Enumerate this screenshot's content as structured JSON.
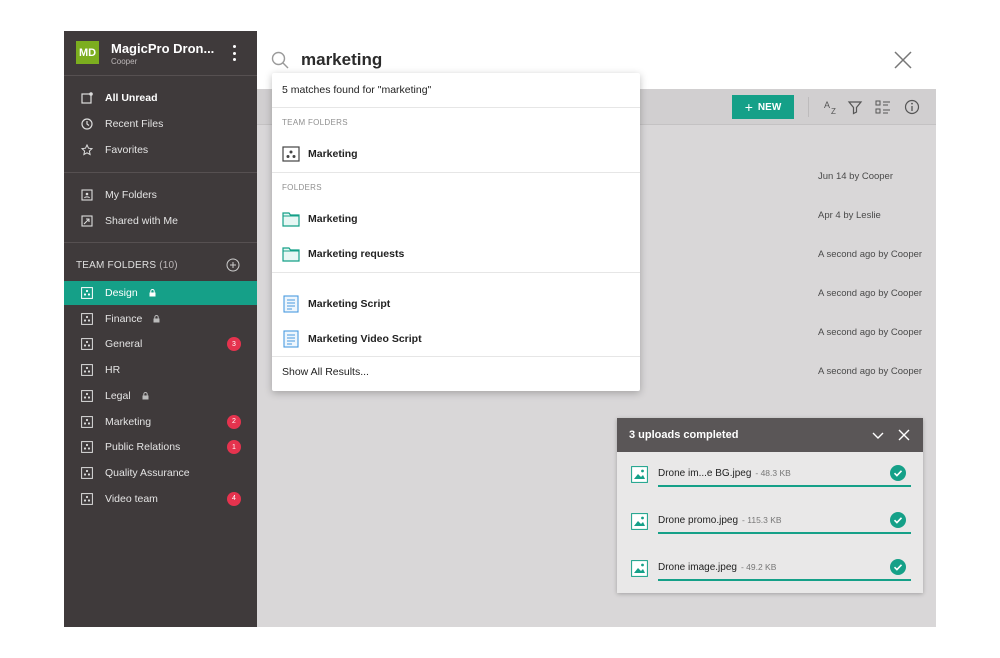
{
  "workspace": {
    "initials": "MD",
    "name": "MagicPro Dron...",
    "user": "Cooper"
  },
  "sidebar": {
    "nav": [
      {
        "label": "All Unread",
        "icon": "unread-icon"
      },
      {
        "label": "Recent Files",
        "icon": "clock-icon"
      },
      {
        "label": "Favorites",
        "icon": "star-icon"
      }
    ],
    "personal": [
      {
        "label": "My Folders",
        "icon": "folder-user-icon"
      },
      {
        "label": "Shared with Me",
        "icon": "folder-shared-icon"
      }
    ],
    "team_folders_title": "TEAM FOLDERS",
    "team_folders_count": "(10)",
    "team_folders": [
      {
        "label": "Design",
        "locked": true,
        "badge": "",
        "active": true
      },
      {
        "label": "Finance",
        "locked": true,
        "badge": ""
      },
      {
        "label": "General",
        "locked": false,
        "badge": "3"
      },
      {
        "label": "HR",
        "locked": false,
        "badge": ""
      },
      {
        "label": "Legal",
        "locked": true,
        "badge": ""
      },
      {
        "label": "Marketing",
        "locked": false,
        "badge": "2"
      },
      {
        "label": "Public Relations",
        "locked": false,
        "badge": "1"
      },
      {
        "label": "Quality Assurance",
        "locked": false,
        "badge": ""
      },
      {
        "label": "Video team",
        "locked": false,
        "badge": "4"
      }
    ]
  },
  "search": {
    "query": "marketing"
  },
  "toolbar": {
    "new_label": "NEW"
  },
  "file_rows": [
    "Jun 14 by Cooper",
    "Apr 4 by Leslie",
    "A second ago by Cooper",
    "A second ago by Cooper",
    "A second ago by Cooper",
    "A second ago by Cooper"
  ],
  "dropdown": {
    "matches": "5 matches found for \"marketing\"",
    "team_folders_section": "TEAM FOLDERS",
    "team_folders": [
      "Marketing"
    ],
    "folders_section": "FOLDERS",
    "folders": [
      "Marketing",
      "Marketing requests"
    ],
    "documents": [
      "Marketing Script",
      "Marketing Video Script"
    ],
    "show_all": "Show All Results..."
  },
  "uploads": {
    "title": "3 uploads completed",
    "items": [
      {
        "name": "Drone im...e BG.jpeg",
        "size": "- 48.3 KB"
      },
      {
        "name": "Drone promo.jpeg",
        "size": "- 115.3 KB"
      },
      {
        "name": "Drone image.jpeg",
        "size": "- 49.2 KB"
      }
    ]
  },
  "colors": {
    "accent": "#15a088",
    "sidebar": "#3f3a3b",
    "badge": "#e5334e",
    "avatar": "#7cae1f"
  }
}
